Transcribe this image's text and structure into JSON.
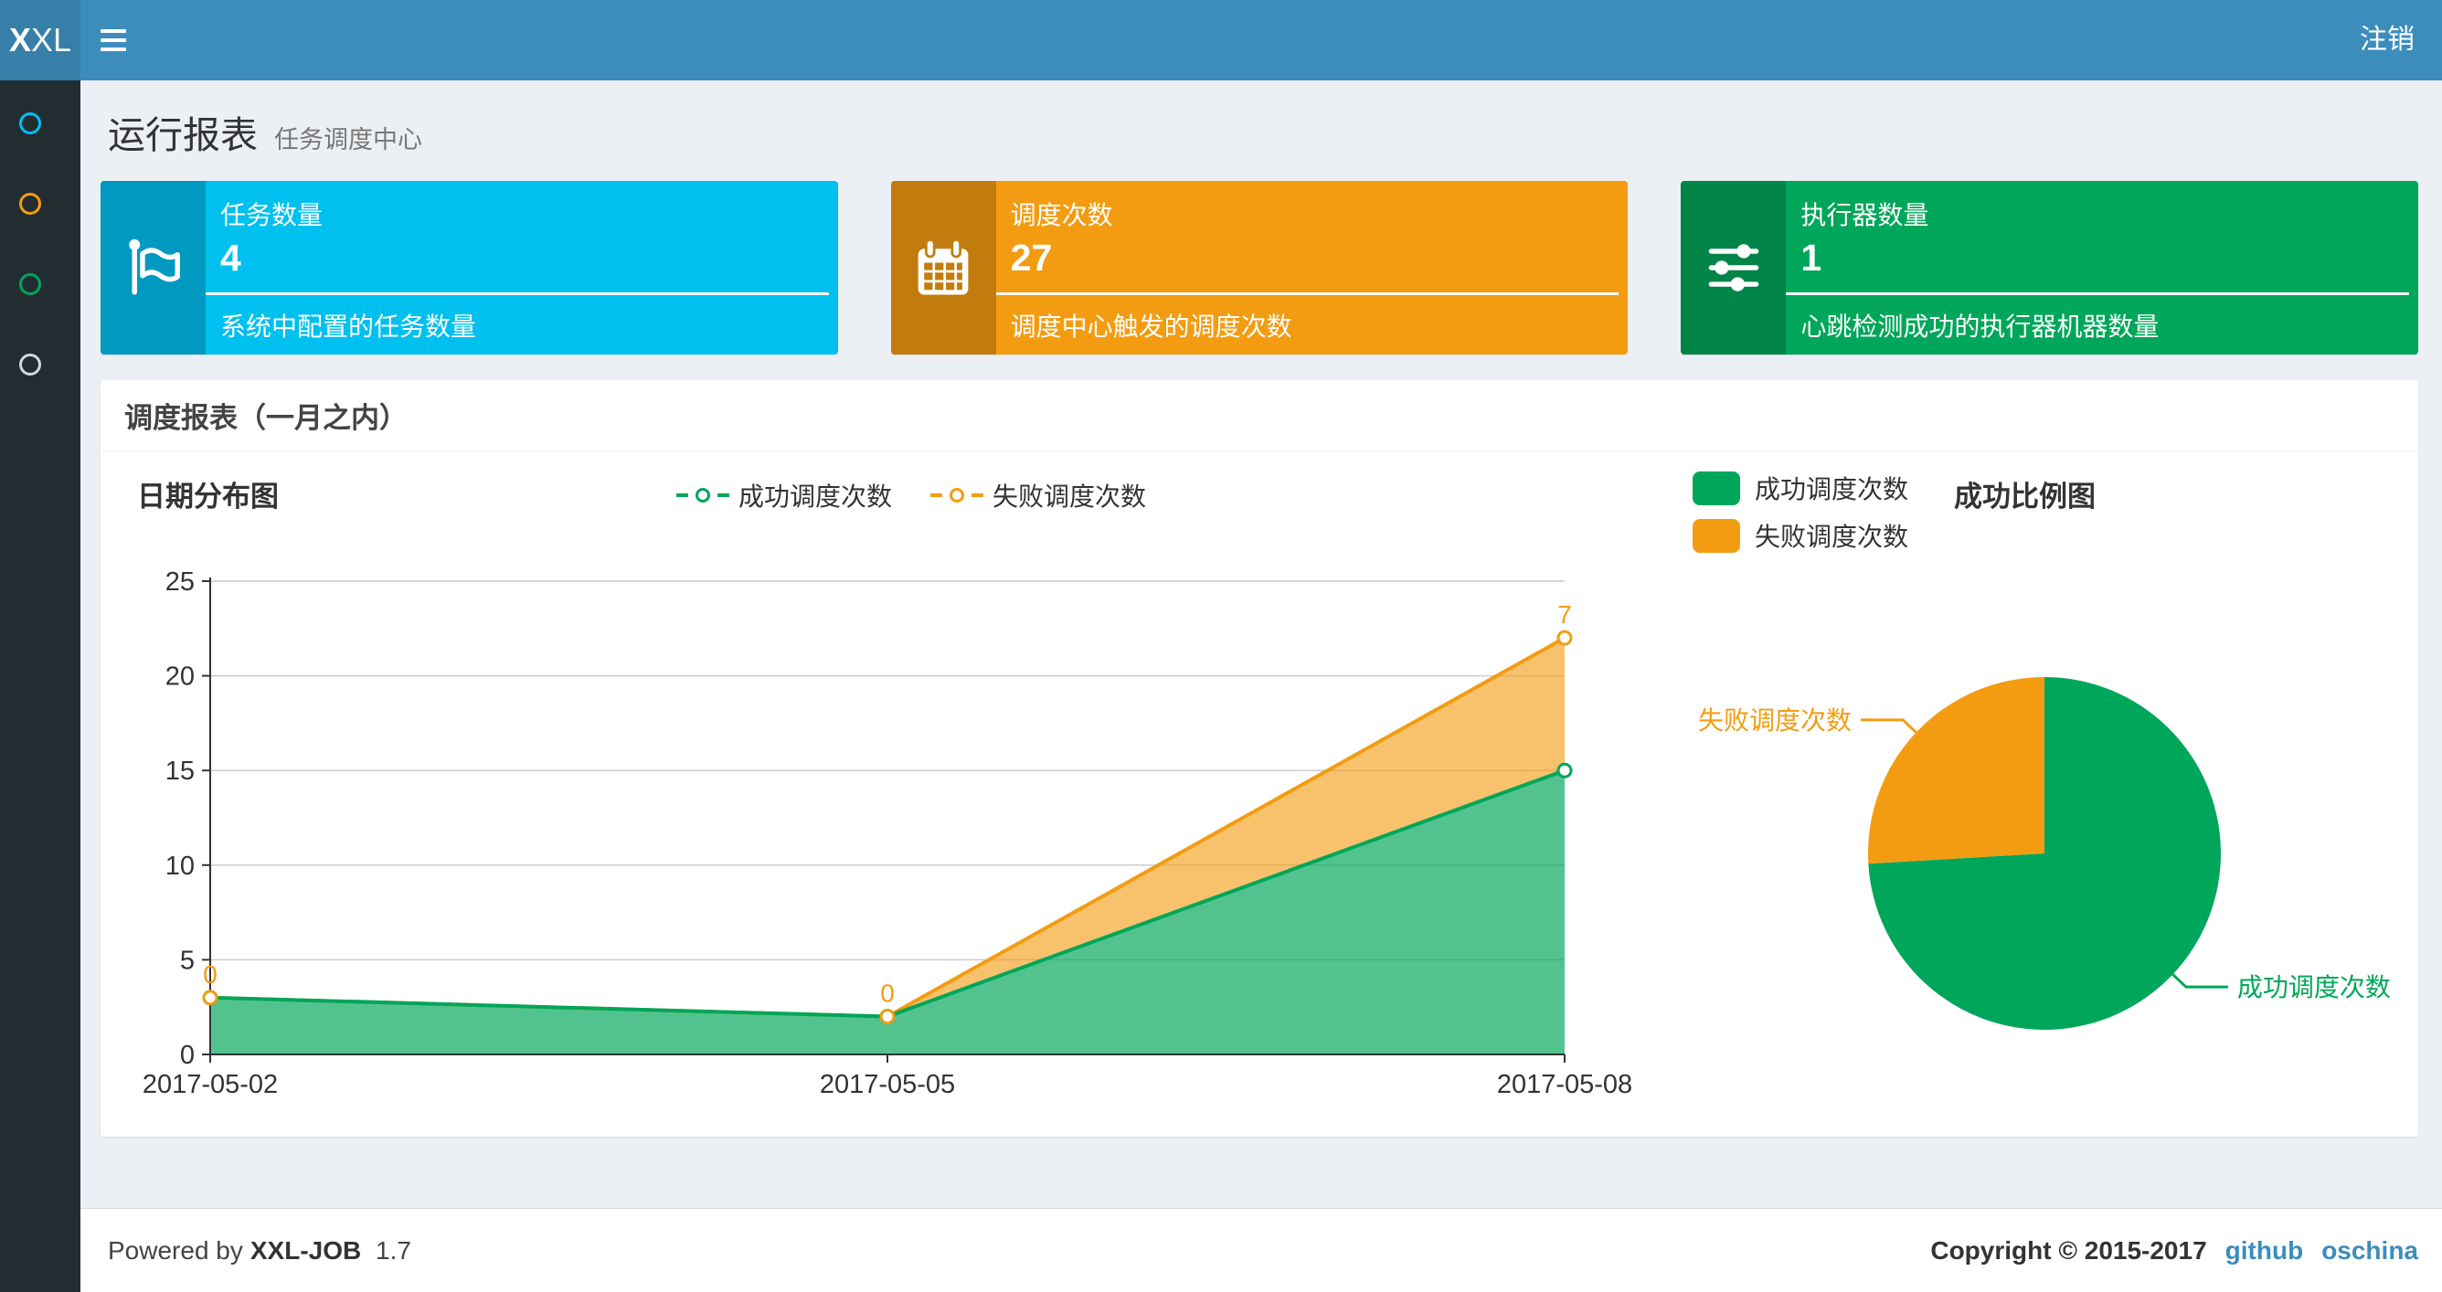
{
  "navbar": {
    "logo_bold": "X",
    "logo_light": "XL",
    "logout_label": "注销"
  },
  "sidebar": {
    "items": [
      {
        "icon": "circle-icon",
        "color": "#00c0ef"
      },
      {
        "icon": "circle-icon",
        "color": "#f39c12"
      },
      {
        "icon": "circle-icon",
        "color": "#00a65a"
      },
      {
        "icon": "circle-icon",
        "color": "#d2d6de"
      }
    ]
  },
  "page": {
    "title": "运行报表",
    "subtitle": "任务调度中心"
  },
  "info_boxes": [
    {
      "label": "任务数量",
      "value": "4",
      "desc": "系统中配置的任务数量",
      "color": "#00c0ef",
      "icon": "flag-icon"
    },
    {
      "label": "调度次数",
      "value": "27",
      "desc": "调度中心触发的调度次数",
      "color": "#f39c12",
      "icon": "calendar-icon"
    },
    {
      "label": "执行器数量",
      "value": "1",
      "desc": "心跳检测成功的执行器机器数量",
      "color": "#00a65a",
      "icon": "sliders-icon"
    }
  ],
  "panel": {
    "title": "调度报表（一月之内）"
  },
  "chart_data": [
    {
      "type": "area",
      "title": "日期分布图",
      "categories": [
        "2017-05-02",
        "2017-05-05",
        "2017-05-08"
      ],
      "series": [
        {
          "name": "成功调度次数",
          "values": [
            3,
            2,
            15
          ],
          "color": "#00a65a",
          "fill": "rgba(0,166,90,0.68)",
          "show_labels": false
        },
        {
          "name": "失败调度次数",
          "values": [
            0,
            0,
            7
          ],
          "color": "#f39c12",
          "fill": "rgba(243,156,18,0.62)",
          "show_labels": true,
          "stack_on_previous": true
        }
      ],
      "stacked": true,
      "ylim": [
        0,
        25
      ],
      "ytick": 5,
      "grid": true,
      "legend_position": "top-center"
    },
    {
      "type": "pie",
      "title": "成功比例图",
      "slices": [
        {
          "label": "成功调度次数",
          "value": 20,
          "color": "#00a65a"
        },
        {
          "label": "失败调度次数",
          "value": 7,
          "color": "#f39c12"
        }
      ],
      "start_angle": 90,
      "clockwise": true,
      "legend_position": "top-left"
    }
  ],
  "footer": {
    "powered_by": "Powered by",
    "product": "XXL-JOB",
    "version": "1.7",
    "copyright": "Copyright © 2015-2017",
    "links": [
      {
        "label": "github"
      },
      {
        "label": "oschina"
      }
    ],
    "link_color": "#3c8dbc"
  }
}
